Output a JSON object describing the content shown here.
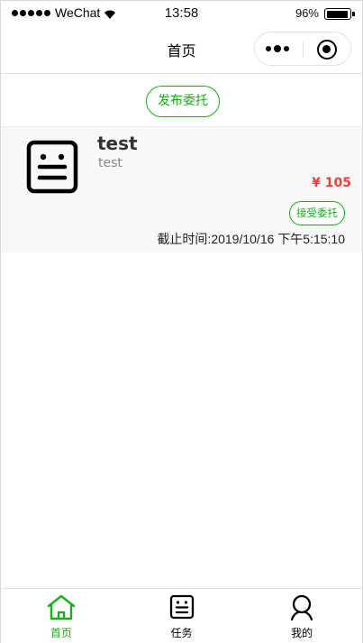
{
  "status_bar": {
    "carrier": "WeChat",
    "time": "13:58",
    "battery": "96%"
  },
  "nav": {
    "title": "首页"
  },
  "publish_button": "发布委托",
  "tasks": [
    {
      "icon": "task-list-icon",
      "title": "test",
      "description": "test",
      "price": "¥ 105",
      "accept_label": "接受委托",
      "deadline": "截止时间:2019/10/16 下午5:15:10"
    }
  ],
  "tab_bar": {
    "items": [
      {
        "label": "首页",
        "icon": "home-icon",
        "active": true
      },
      {
        "label": "任务",
        "icon": "task-icon",
        "active": false
      },
      {
        "label": "我的",
        "icon": "user-icon",
        "active": false
      }
    ]
  },
  "colors": {
    "accent": "#1aad19",
    "price": "#e64340",
    "card_bg": "#f8f8f8"
  }
}
